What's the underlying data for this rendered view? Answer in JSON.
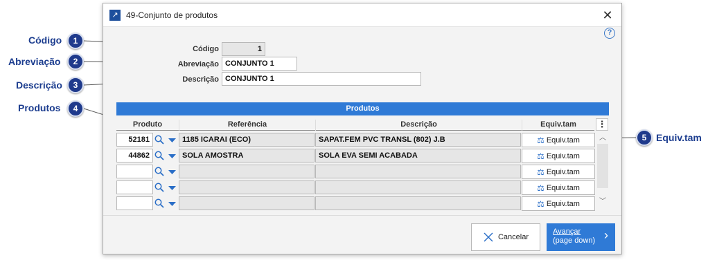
{
  "callouts": [
    {
      "number": "1",
      "label": "Código"
    },
    {
      "number": "2",
      "label": "Abreviação"
    },
    {
      "number": "3",
      "label": "Descrição"
    },
    {
      "number": "4",
      "label": "Produtos"
    },
    {
      "number": "5",
      "label": "Equiv.tam"
    }
  ],
  "dialog": {
    "title": "49-Conjunto de produtos",
    "title_icon": "arrow-northeast-icon",
    "close_glyph": "✕",
    "help_glyph": "?"
  },
  "form": {
    "codigo_label": "Código",
    "codigo_value": "1",
    "abreviacao_label": "Abreviação",
    "abreviacao_value": "CONJUNTO 1",
    "descricao_label": "Descrição",
    "descricao_value": "CONJUNTO 1"
  },
  "grid": {
    "title": "Produtos",
    "columns": [
      "Produto",
      "Referência",
      "Descrição",
      "Equiv.tam"
    ],
    "menu_glyph": "⋮",
    "rows": [
      {
        "produto": "52181",
        "referencia": "1185 ICARAI (ECO)",
        "descricao": "SAPAT.FEM PVC TRANSL (802) J.B",
        "equiv": "Equiv.tam"
      },
      {
        "produto": "44862",
        "referencia": "SOLA AMOSTRA",
        "descricao": "SOLA EVA SEMI ACABADA",
        "equiv": "Equiv.tam"
      },
      {
        "produto": "",
        "referencia": "",
        "descricao": "",
        "equiv": "Equiv.tam"
      },
      {
        "produto": "",
        "referencia": "",
        "descricao": "",
        "equiv": "Equiv.tam"
      },
      {
        "produto": "",
        "referencia": "",
        "descricao": "",
        "equiv": "Equiv.tam"
      }
    ]
  },
  "buttons": {
    "cancel": "Cancelar",
    "next_line1": "Avançar",
    "next_line2": "(page down)"
  },
  "colors": {
    "accent": "#2f7ad6",
    "callout": "#1f3a8c"
  }
}
